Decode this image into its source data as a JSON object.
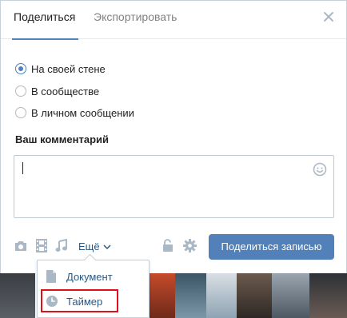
{
  "tabs": {
    "share": "Поделиться",
    "export": "Экспортировать"
  },
  "share_target": {
    "options": [
      "На своей стене",
      "В сообществе",
      "В личном сообщении"
    ],
    "selected": "На своей стене"
  },
  "comment": {
    "label": "Ваш комментарий",
    "value": ""
  },
  "toolbar": {
    "more_label": "Ещё",
    "submit_label": "Поделиться записью"
  },
  "more_menu": {
    "items": [
      {
        "label": "Документ",
        "icon": "document-icon"
      },
      {
        "label": "Таймер",
        "icon": "timer-icon"
      }
    ],
    "highlighted": "Таймер"
  },
  "colors": {
    "accent": "#5181b8",
    "link": "#2a5885",
    "icon_gray": "#aab7c4",
    "highlight_red": "#e0101a"
  }
}
